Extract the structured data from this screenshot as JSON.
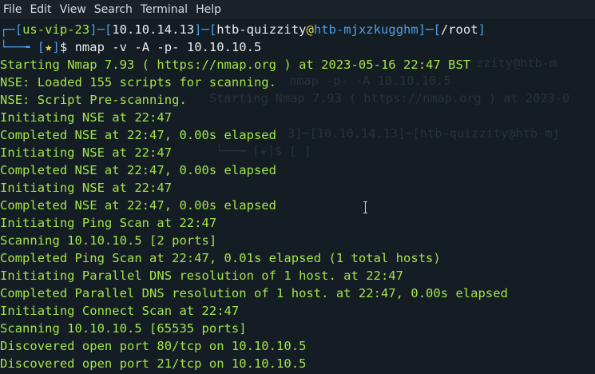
{
  "menu": {
    "items": [
      {
        "label": "File"
      },
      {
        "label": "Edit"
      },
      {
        "label": "View"
      },
      {
        "label": "Search"
      },
      {
        "label": "Terminal"
      },
      {
        "label": "Help"
      }
    ]
  },
  "prompt": {
    "vpn": "us-vip-23",
    "ip": "10.10.14.13",
    "user": "htb-quizzity",
    "host": "htb-mjxzkugghm",
    "dir": "/root",
    "star": "★",
    "command": "nmap -v -A -p- 10.10.10.5"
  },
  "output": {
    "lines": [
      "Starting Nmap 7.93 ( https://nmap.org ) at 2023-05-16 22:47 BST",
      "NSE: Loaded 155 scripts for scanning.",
      "NSE: Script Pre-scanning.",
      "Initiating NSE at 22:47",
      "Completed NSE at 22:47, 0.00s elapsed",
      "Initiating NSE at 22:47",
      "Completed NSE at 22:47, 0.00s elapsed",
      "Initiating NSE at 22:47",
      "Completed NSE at 22:47, 0.00s elapsed",
      "Initiating Ping Scan at 22:47",
      "Scanning 10.10.10.5 [2 ports]",
      "Completed Ping Scan at 22:47, 0.01s elapsed (1 total hosts)",
      "Initiating Parallel DNS resolution of 1 host. at 22:47",
      "Completed Parallel DNS resolution of 1 host. at 22:47, 0.00s elapsed",
      "Initiating Connect Scan at 22:47",
      "Scanning 10.10.10.5 [65535 ports]",
      "Discovered open port 80/tcp on 10.10.10.5",
      "Discovered open port 21/tcp on 10.10.10.5"
    ]
  },
  "background": {
    "ghost1": "zzity@htb-m",
    "ghost2": "nmap -p- -A 10.10.10.5",
    "ghost3": "Starting Nmap 7.93 ( https://nmap.org ) at 2023-0",
    "ghost4": "3]─[10.10.14.13]─[htb-quizzity@htb-mj",
    "ghost5": "└──╼ [★]$ [ ]"
  },
  "colors": {
    "bg": "#141c24",
    "green": "#a4e34a",
    "blue": "#4f9fe8",
    "yellow": "#e5d84a",
    "white": "#e8ecef"
  }
}
